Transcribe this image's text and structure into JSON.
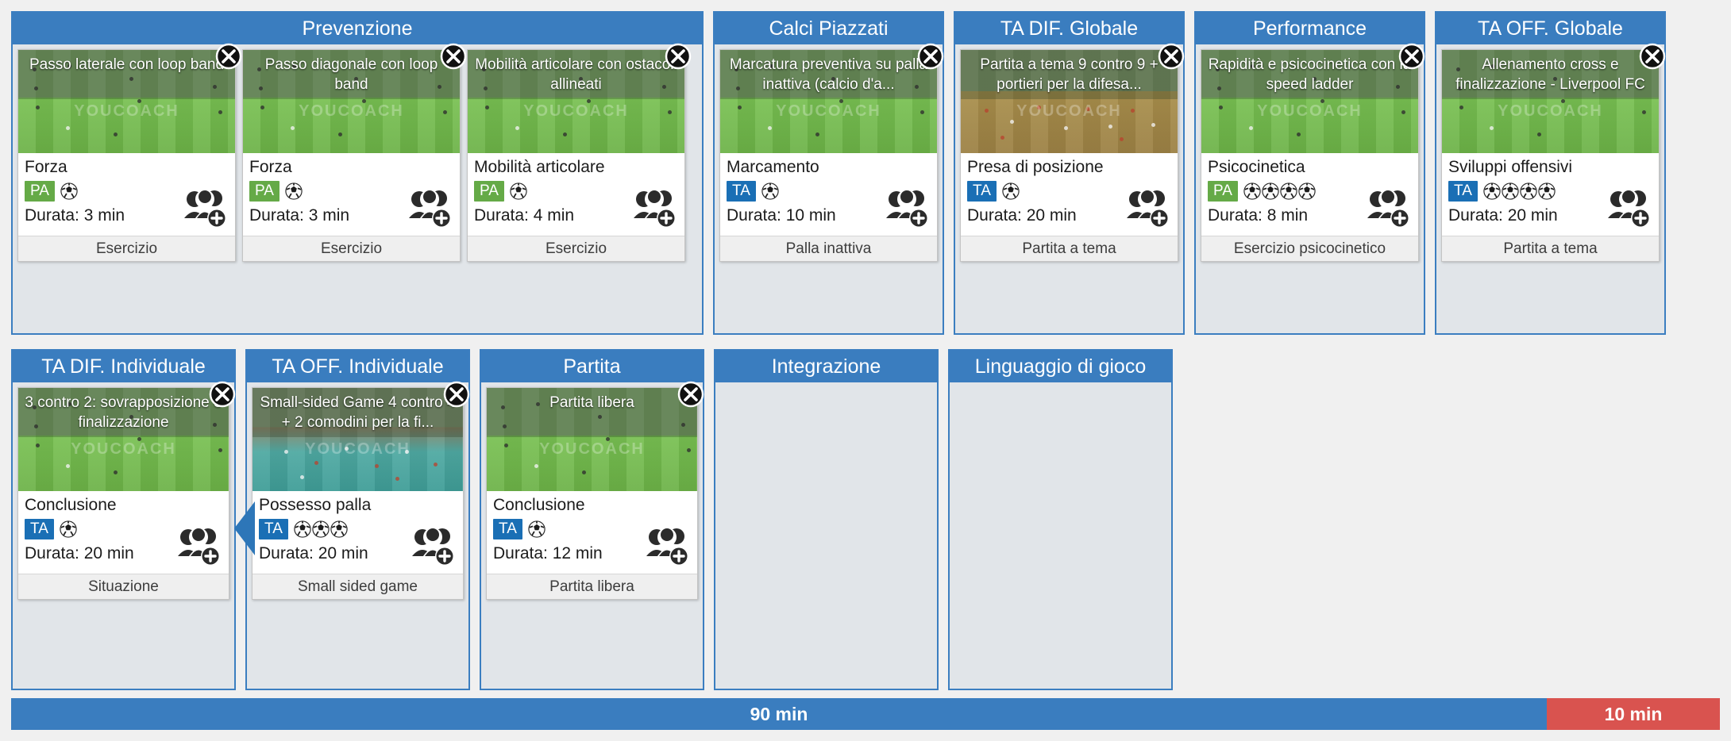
{
  "colors": {
    "header_blue": "#3a7dbf",
    "column_bg": "#e1e5e9",
    "badge_pa_green": "#65aa47",
    "badge_ta_blue": "#1a6fb5",
    "time_main_blue": "#3a7dbf",
    "time_extra_red": "#d9534f",
    "page_bg": "#f0f0f0"
  },
  "icons": {
    "close": "close-icon",
    "ball": "soccer-ball-icon",
    "people": "add-players-icon",
    "arrow": "flow-arrow-icon"
  },
  "rows": [
    {
      "columns": [
        {
          "title": "Prevenzione",
          "width": "wide",
          "cards": [
            {
              "title": "Passo laterale con loop band",
              "objective": "Forza",
              "badge": "PA",
              "badge_type": "pa",
              "balls": 1,
              "duration": "Durata: 3 min",
              "category": "Esercizio",
              "pitch": "green"
            },
            {
              "title": "Passo diagonale con loop band",
              "objective": "Forza",
              "badge": "PA",
              "badge_type": "pa",
              "balls": 1,
              "duration": "Durata: 3 min",
              "category": "Esercizio",
              "pitch": "green"
            },
            {
              "title": "Mobilità articolare con ostacoli allineati",
              "objective": "Mobilità articolare",
              "badge": "PA",
              "badge_type": "pa",
              "balls": 1,
              "duration": "Durata: 4 min",
              "category": "Esercizio",
              "pitch": "green"
            }
          ]
        },
        {
          "title": "Calci Piazzati",
          "width": "std",
          "cards": [
            {
              "title": "Marcatura preventiva su palla inattiva (calcio d'a...",
              "objective": "Marcamento",
              "badge": "TA",
              "badge_type": "ta",
              "balls": 1,
              "duration": "Durata: 10 min",
              "category": "Palla inattiva",
              "pitch": "green"
            }
          ]
        },
        {
          "title": "TA DIF. Globale",
          "width": "std",
          "cards": [
            {
              "title": "Partita a tema 9 contro 9 + portieri per la difesa...",
              "objective": "Presa di posizione",
              "badge": "TA",
              "badge_type": "ta",
              "balls": 1,
              "duration": "Durata: 20 min",
              "category": "Partita a tema",
              "pitch": "brown"
            }
          ]
        },
        {
          "title": "Performance",
          "width": "std",
          "cards": [
            {
              "title": "Rapidità e psicocinetica con la speed ladder",
              "objective": "Psicocinetica",
              "badge": "PA",
              "badge_type": "pa",
              "balls": 4,
              "duration": "Durata: 8 min",
              "category": "Esercizio psicocinetico",
              "pitch": "green"
            }
          ]
        },
        {
          "title": "TA OFF. Globale",
          "width": "std",
          "cards": [
            {
              "title": "Allenamento cross e finalizzazione - Liverpool FC",
              "objective": "Sviluppi offensivi",
              "badge": "TA",
              "badge_type": "ta",
              "balls": 4,
              "duration": "Durata: 20 min",
              "category": "Partita a tema",
              "pitch": "green"
            }
          ]
        }
      ]
    },
    {
      "columns": [
        {
          "title": "TA DIF. Individuale",
          "width": "std2",
          "cards": [
            {
              "title": "3 contro 2: sovrapposizione e finalizzazione",
              "objective": "Conclusione",
              "badge": "TA",
              "badge_type": "ta",
              "balls": 1,
              "duration": "Durata: 20 min",
              "category": "Situazione",
              "pitch": "green"
            }
          ]
        },
        {
          "title": "TA OFF. Individuale",
          "width": "std2",
          "cards": [
            {
              "title": "Small-sided Game 4 contro 4 + 2 comodini per la fi...",
              "objective": "Possesso palla",
              "badge": "TA",
              "badge_type": "ta",
              "balls": 3,
              "duration": "Durata: 20 min",
              "category": "Small sided game",
              "pitch": "teal"
            }
          ]
        },
        {
          "title": "Partita",
          "width": "std2",
          "cards": [
            {
              "title": "Partita libera",
              "objective": "Conclusione",
              "badge": "TA",
              "badge_type": "ta",
              "balls": 1,
              "duration": "Durata: 12 min",
              "category": "Partita libera",
              "pitch": "green"
            }
          ]
        },
        {
          "title": "Integrazione",
          "width": "std2",
          "cards": []
        },
        {
          "title": "Linguaggio di gioco",
          "width": "std2",
          "cards": []
        }
      ]
    }
  ],
  "timebar": {
    "main_label": "90 min",
    "extra_label": "10 min"
  }
}
